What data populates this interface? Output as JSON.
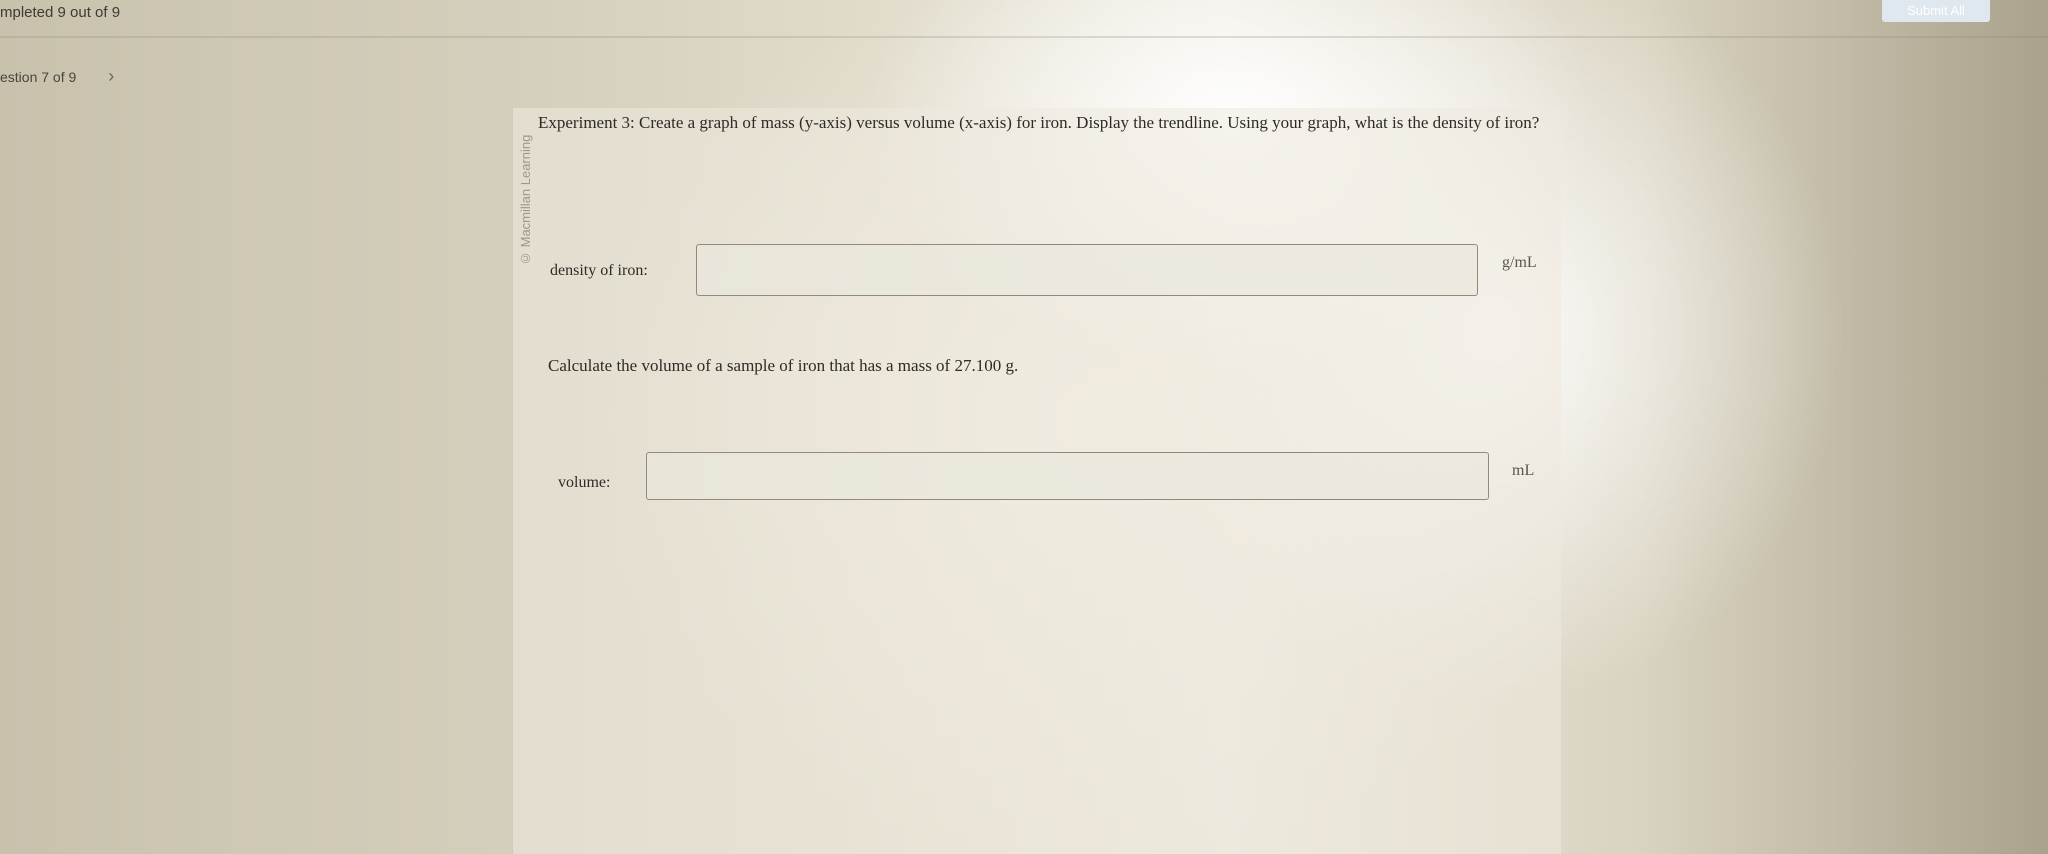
{
  "header": {
    "progress_text": "mpleted 9 out of 9",
    "submit_label": "Submit All"
  },
  "nav": {
    "question_label": "estion 7 of 9",
    "next_icon": "chevron-right-icon"
  },
  "question": {
    "credit": "© Macmillan Learning",
    "prompt": "Experiment 3: Create a graph of mass (y-axis) versus volume (x-axis) for iron. Display the trendline. Using your graph, what is the density of iron?",
    "density": {
      "label": "density of iron:",
      "value": "",
      "unit": "g/mL"
    },
    "prompt2": "Calculate the volume of a sample of iron that has a mass of 27.100 g.",
    "volume": {
      "label": "volume:",
      "value": "",
      "unit": "mL"
    }
  },
  "colors": {
    "submit_button": "#dfe8ee",
    "text": "#2d2b26"
  }
}
